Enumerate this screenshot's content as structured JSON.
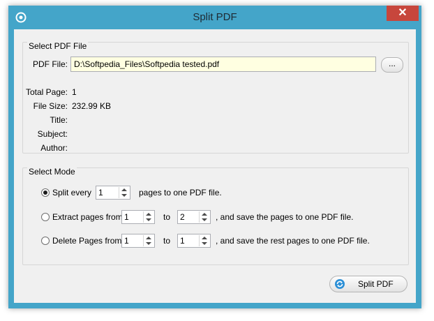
{
  "window": {
    "title": "Split PDF",
    "close_label": "✕"
  },
  "select_file": {
    "group_label": "Select PDF File",
    "pdf_file_label": "PDF File:",
    "pdf_file_value": "D:\\Softpedia_Files\\Softpedia tested.pdf",
    "browse_label": "...",
    "info": [
      {
        "label": "Total Page:",
        "value": "1"
      },
      {
        "label": "File Size:",
        "value": "232.99 KB"
      },
      {
        "label": "Title:",
        "value": ""
      },
      {
        "label": "Subject:",
        "value": ""
      },
      {
        "label": "Author:",
        "value": ""
      }
    ]
  },
  "select_mode": {
    "group_label": "Select Mode",
    "split_every": {
      "label": "Split every",
      "value": "1",
      "suffix": "pages to one PDF file.",
      "checked": true
    },
    "extract": {
      "label": "Extract pages  from",
      "from": "1",
      "to_label": "to",
      "to": "2",
      "suffix": ", and save the pages to one PDF file.",
      "checked": false
    },
    "delete": {
      "label": "Delete Pages  from",
      "from": "1",
      "to_label": "to",
      "to": "1",
      "suffix": ", and save the rest pages to one PDF file.",
      "checked": false
    }
  },
  "actions": {
    "split_label": "Split PDF"
  },
  "colors": {
    "titlebar": "#44a5c9",
    "close": "#c7463c",
    "input_bg": "#ffffe1"
  }
}
